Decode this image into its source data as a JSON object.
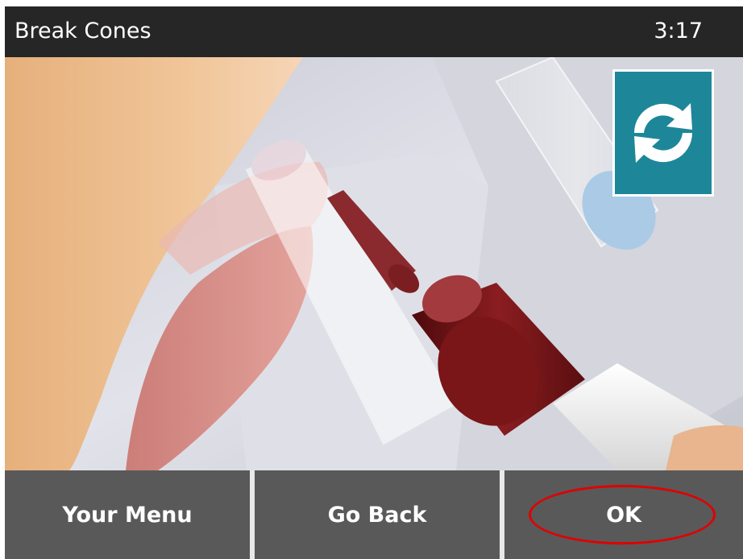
{
  "header": {
    "title": "Break Cones",
    "time": "3:17"
  },
  "scene": {
    "description_icon": "instruction-animation"
  },
  "replay": {
    "icon": "refresh-icon",
    "color": "#1d8799"
  },
  "softkeys": {
    "left": "Your Menu",
    "middle": "Go Back",
    "right": "OK"
  },
  "highlight": {
    "color": "#e00000",
    "target": "OK"
  }
}
